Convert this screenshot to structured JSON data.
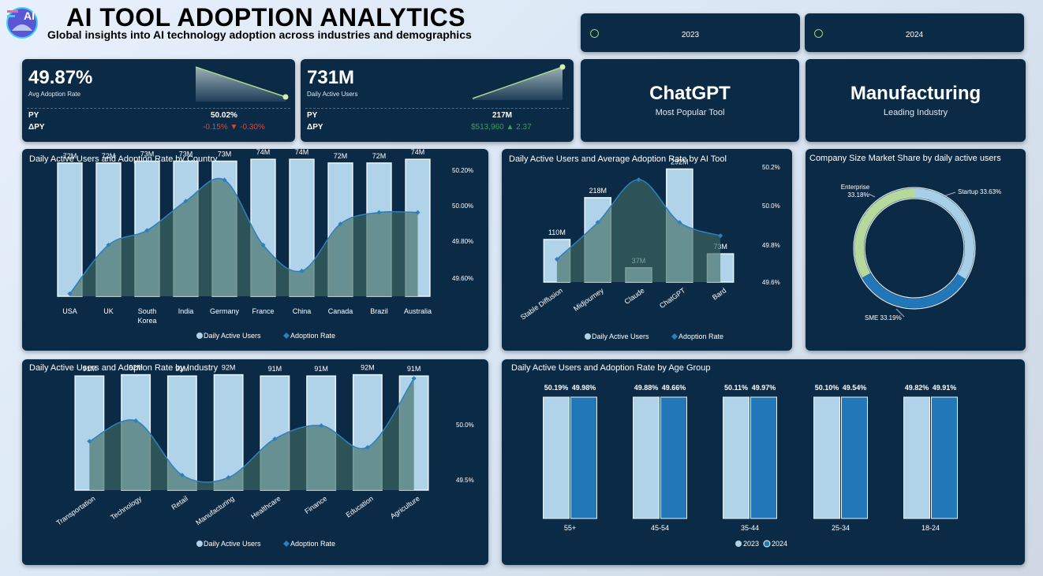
{
  "header": {
    "title": "AI TOOL ADOPTION ANALYTICS",
    "subtitle": "Global insights into AI technology adoption across industries and demographics",
    "logo_icon": "ai-logo-icon"
  },
  "slicers": [
    {
      "label": "2023"
    },
    {
      "label": "2024"
    }
  ],
  "kpi_adoption": {
    "value": "49.87%",
    "label": "Avg Adoption Rate",
    "py_label": "PY",
    "py_value": "50.02%",
    "dpy_label": "ΔPY",
    "dpy_value": "-0.15% ▼ -0.30%",
    "dpy_color": "#e0453a"
  },
  "kpi_users": {
    "value": "731M",
    "label": "Daily Active Users",
    "py_label": "PY",
    "py_value": "217M",
    "dpy_label": "ΔPY",
    "dpy_value": "$513,960 ▲ 2.37",
    "dpy_color": "#2ea84a"
  },
  "top_tool": {
    "value": "ChatGPT",
    "label": "Most Popular Tool"
  },
  "top_industry": {
    "value": "Manufacturing",
    "label": "Leading Industry"
  },
  "colors": {
    "bar": "#b0d3ea",
    "bar_border": "#e8f4fb",
    "line": "#2f7fbf",
    "area": "#3f6b63",
    "bar2024": "#2277b8",
    "donut_green": "#b5d99c",
    "donut_light": "#a8cfe8",
    "donut_blue": "#2277b8"
  },
  "chart_data": [
    {
      "type": "bar",
      "title": "Daily Active Users and Adoption Rate by Country",
      "categories": [
        "USA",
        "UK",
        "South Korea",
        "India",
        "Germany",
        "France",
        "China",
        "Canada",
        "Brazil",
        "Australia"
      ],
      "series": [
        {
          "name": "Daily Active Users",
          "values": [
            72,
            72,
            73,
            73,
            73,
            74,
            74,
            72,
            72,
            74
          ],
          "labels": [
            "72M",
            "72M",
            "73M",
            "73M",
            "73M",
            "74M",
            "74M",
            "72M",
            "72M",
            "74M"
          ]
        },
        {
          "name": "Adoption Rate",
          "values": [
            49.49,
            49.79,
            49.88,
            50.06,
            50.19,
            49.79,
            49.63,
            49.92,
            49.99,
            49.99
          ]
        }
      ],
      "y2_ticks": [
        "50.20%",
        "50.00%",
        "49.80%",
        "49.60%"
      ],
      "legend": [
        "Daily Active Users",
        "Adoption Rate"
      ]
    },
    {
      "type": "bar",
      "title": "Daily Active Users and Average Adoption Rate by AI Tool",
      "categories": [
        "Stable Diffusion",
        "Midjourney",
        "Claude",
        "ChatGPT",
        "Bard"
      ],
      "series": [
        {
          "name": "Daily Active Users",
          "values": [
            110,
            218,
            37,
            292,
            73
          ],
          "labels": [
            "110M",
            "218M",
            "37M",
            "292M",
            "73M"
          ]
        },
        {
          "name": "Adoption Rate",
          "values": [
            49.66,
            49.91,
            50.2,
            49.91,
            49.82
          ]
        }
      ],
      "y2_ticks": [
        "50.2%",
        "50.0%",
        "49.8%",
        "49.6%"
      ],
      "legend": [
        "Daily Active Users",
        "Adoption Rate"
      ]
    },
    {
      "type": "pie",
      "title": "Company Size Market Share by daily active users",
      "slices": [
        {
          "name": "Startup",
          "value": 33.63,
          "label": "Startup 33.63%"
        },
        {
          "name": "SME",
          "value": 33.19,
          "label": "SME 33.19%"
        },
        {
          "name": "Enterprise",
          "value": 33.18,
          "label": "Enterprise 33.18%",
          "label_line1": "Enterprise",
          "label_line2": "33.18%"
        }
      ]
    },
    {
      "type": "bar",
      "title": "Daily Active Users and Adoption Rate by Industry",
      "categories": [
        "Transportation",
        "Technology",
        "Retail",
        "Manufacturing",
        "Healthcare",
        "Finance",
        "Education",
        "Agriculture"
      ],
      "series": [
        {
          "name": "Daily Active Users",
          "values": [
            91,
            92,
            91,
            92,
            91,
            91,
            92,
            91
          ],
          "labels": [
            "91M",
            "92M",
            "91M",
            "92M",
            "91M",
            "91M",
            "92M",
            "91M"
          ]
        },
        {
          "name": "Adoption Rate",
          "values": [
            49.83,
            50.0,
            49.55,
            49.53,
            49.85,
            49.96,
            49.78,
            50.35
          ]
        }
      ],
      "y2_ticks": [
        "50.0%",
        "49.5%"
      ],
      "legend": [
        "Daily Active Users",
        "Adoption Rate"
      ]
    },
    {
      "type": "bar",
      "title": "Daily Active Users and Adoption Rate by Age Group",
      "categories": [
        "55+",
        "45-54",
        "35-44",
        "25-34",
        "18-24"
      ],
      "series": [
        {
          "name": "2023",
          "values": [
            50.19,
            49.88,
            50.11,
            50.1,
            49.82
          ],
          "labels": [
            "50.19%",
            "49.88%",
            "50.11%",
            "50.10%",
            "49.82%"
          ]
        },
        {
          "name": "2024",
          "values": [
            49.98,
            49.66,
            49.97,
            49.54,
            49.91
          ],
          "labels": [
            "49.98%",
            "49.66%",
            "49.97%",
            "49.54%",
            "49.91%"
          ]
        }
      ],
      "legend": [
        "2023",
        "2024"
      ]
    }
  ]
}
